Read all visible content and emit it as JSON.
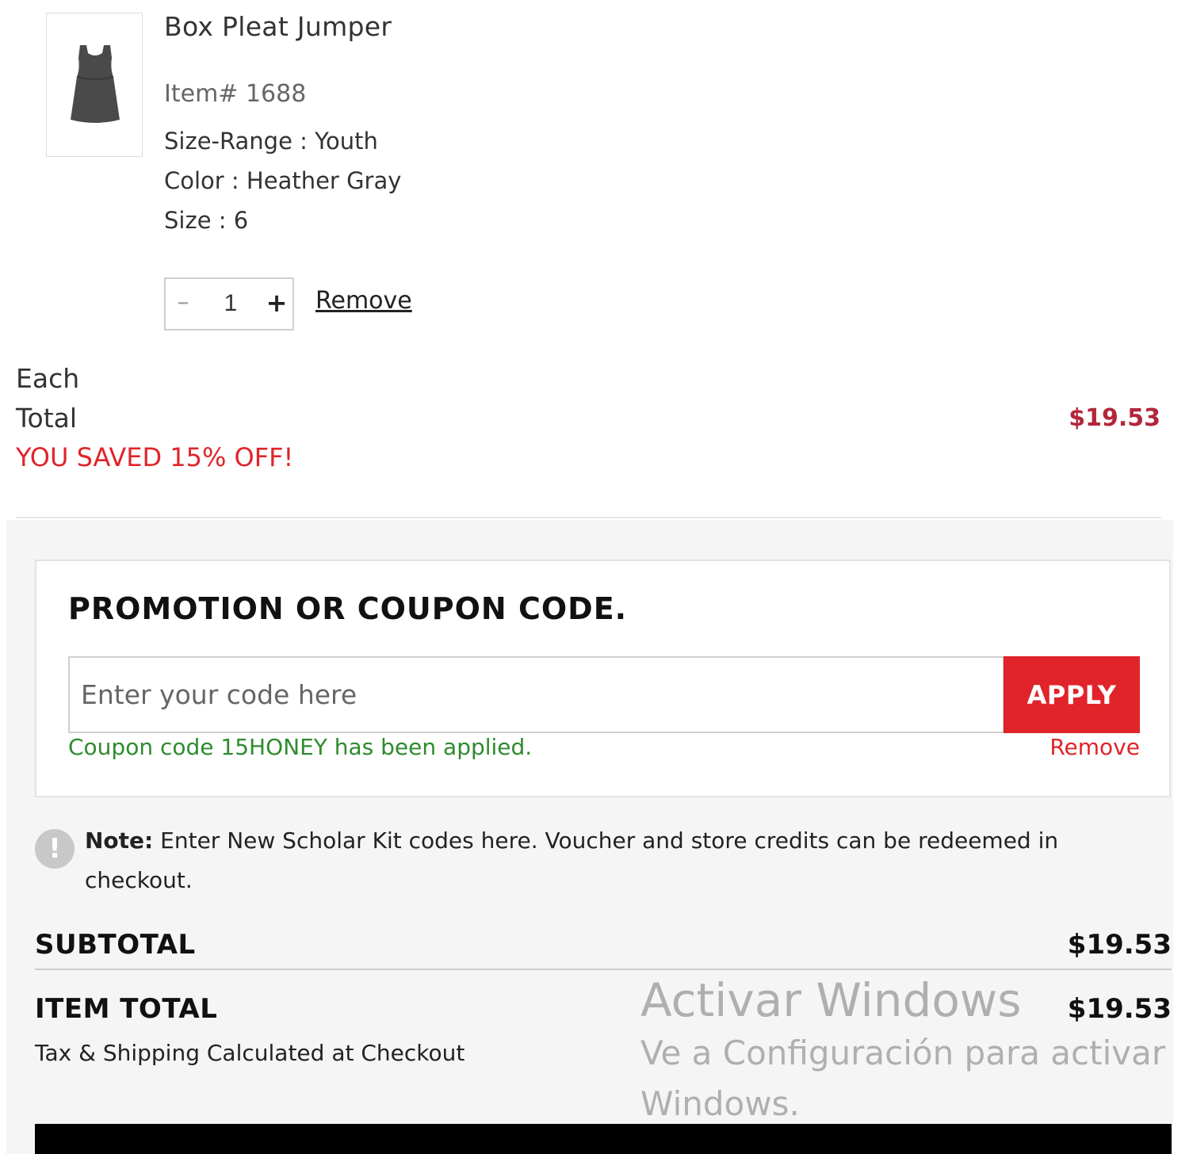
{
  "product": {
    "name": "Box Pleat Jumper",
    "item_number": "Item# 1688",
    "size_range": "Size-Range : Youth",
    "color": "Color : Heather Gray",
    "size": "Size : 6",
    "image_icon": "jumper-dress-icon",
    "quantity": "1",
    "qty_minus": "–",
    "qty_plus": "+",
    "remove_label": "Remove"
  },
  "pricing": {
    "each_label": "Each",
    "total_label": "Total",
    "total_value": "$19.53",
    "saved_text": "YOU SAVED 15% OFF!"
  },
  "coupon": {
    "title": "PROMOTION OR COUPON CODE.",
    "placeholder": "Enter your code here",
    "apply_label": "APPLY",
    "applied_message": "Coupon code 15HONEY has been applied.",
    "remove_label": "Remove"
  },
  "note": {
    "icon": "exclamation-icon",
    "label": "Note:",
    "text": "Enter New Scholar Kit codes here. Voucher and store credits can be redeemed in checkout."
  },
  "summary": {
    "subtotal_label": "SUBTOTAL",
    "subtotal_value": "$19.53",
    "item_total_label": "ITEM TOTAL",
    "item_total_value": "$19.53",
    "tax_note": "Tax & Shipping Calculated at Checkout"
  },
  "watermark": {
    "line1": "Activar Windows",
    "line2": "Ve a Configuración para activar",
    "line3": "Windows."
  },
  "colors": {
    "accent_red": "#e0242a",
    "price_red": "#b3263a",
    "success_green": "#2e8b2e",
    "panel_bg": "#f5f5f5"
  }
}
